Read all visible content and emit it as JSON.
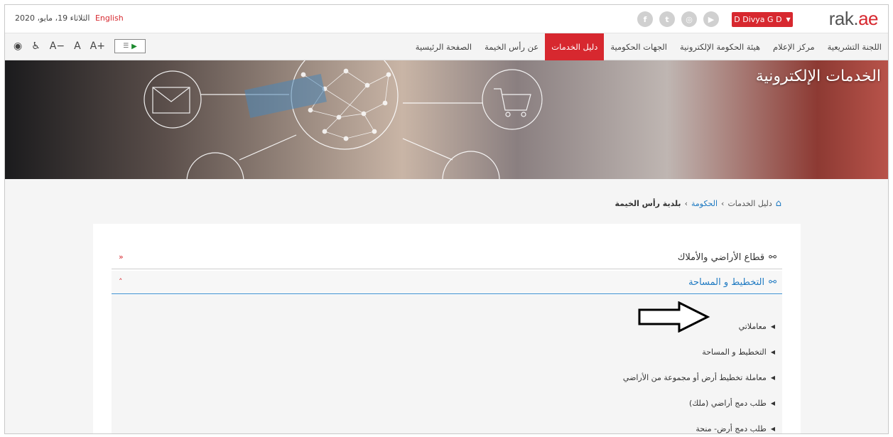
{
  "topbar": {
    "date": "الثلاثاء 19، مايو، 2020",
    "language_link": "English",
    "user_button": "D Divya G D",
    "logo_main": "rak.",
    "logo_accent": "ae",
    "social_icons": [
      "youtube-icon",
      "instagram-icon",
      "twitter-icon",
      "facebook-icon"
    ]
  },
  "nav": {
    "items": [
      "الصفحة الرئيسية",
      "عن رأس الخيمة",
      "دليل الخدمات",
      "الجهات الحكومية",
      "هيئة الحكومة الإلكترونية",
      "مركز الإعلام",
      "اللجنة التشريعية"
    ],
    "active_index": 2,
    "a11y": {
      "font_minus": "A−",
      "font_normal": "A",
      "font_plus": "A+"
    }
  },
  "banner": {
    "title": "الخدمات الإلكترونية"
  },
  "breadcrumb": {
    "item1": "دليل الخدمات",
    "item2": "الحكومة",
    "current": "بلدية رأس الخيمة"
  },
  "accordion": {
    "section1": {
      "label": "قطاع الأراضي والأملاك"
    },
    "section2": {
      "label": "التخطيط و المساحة"
    }
  },
  "service_links": [
    "معاملاتي",
    "التخطيط و المساحة",
    "معاملة تخطيط أرض أو مجموعة من الأراضي",
    "طلب دمج أراضي (ملك)",
    "طلب دمج أرض- منحة"
  ],
  "colors": {
    "accent": "#d7282f",
    "link": "#1f7ac2"
  }
}
